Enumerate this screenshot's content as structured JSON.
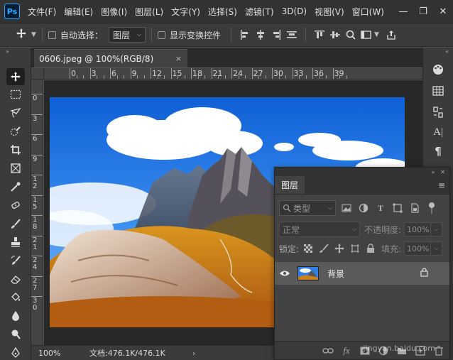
{
  "app": {
    "logo": "Ps"
  },
  "menu": [
    "文件(F)",
    "编辑(E)",
    "图像(I)",
    "图层(L)",
    "文字(Y)",
    "选择(S)",
    "滤镜(T)",
    "3D(D)",
    "视图(V)",
    "窗口(W)"
  ],
  "window_controls": {
    "minimize": "—",
    "restore": "❐",
    "close": "✕"
  },
  "options_bar": {
    "auto_select_label": "自动选择：",
    "auto_select_target": "图层",
    "show_transform_label": "显示变换控件"
  },
  "document": {
    "tab_title": "0606.jpeg @ 100%(RGB/8)",
    "close_glyph": "×",
    "zoom": "100%",
    "doc_info": "文档:476.1K/476.1K",
    "status_arrow": "›"
  },
  "rulers": {
    "top_labels": [
      "0",
      "3",
      "6",
      "9",
      "12",
      "15",
      "18",
      "21",
      "24",
      "27",
      "30",
      "33",
      "36",
      "39"
    ],
    "left_labels": [
      "0",
      "3",
      "6",
      "9",
      "1 2",
      "1 5",
      "1 8",
      "2 1",
      "2 4",
      "2 7",
      "3 0"
    ]
  },
  "layers_panel": {
    "tab": "图层",
    "filter_label": "类型",
    "blend_mode": "正常",
    "opacity_label": "不透明度:",
    "opacity_value": "100%",
    "lock_label": "锁定:",
    "fill_label": "填充:",
    "fill_value": "100%",
    "layers": [
      {
        "name": "背景",
        "visible": true,
        "locked": true
      }
    ]
  },
  "watermark": "jingyan.baidu.com",
  "colors": {
    "accent": "#31a8ff",
    "menubar": "#323232",
    "panel": "#424242"
  }
}
